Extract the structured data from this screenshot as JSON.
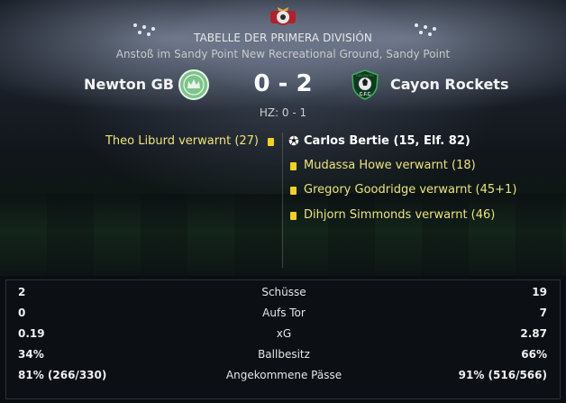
{
  "competition": {
    "title": "TABELLE DER PRIMERA DIVISIÓN",
    "venue": "Anstoß im Sandy Point New Recreational Ground, Sandy Point",
    "logo_icon": "competition-logo"
  },
  "match": {
    "home_team": "Newton GB",
    "away_team": "Cayon Rockets",
    "score": "0 - 2",
    "half_time": "HZ: 0 - 1",
    "home_crest_color": "#7dc48a",
    "away_crest_color": "#1f6a3a",
    "away_crest_text": "CAYON FC"
  },
  "events": {
    "home": [
      {
        "text": "Theo Liburd verwarnt (27)",
        "type": "yellow-card"
      }
    ],
    "away": [
      {
        "text": "Carlos Bertie (15, Elf. 82)",
        "type": "goal"
      },
      {
        "text": "Mudassa Howe verwarnt (18)",
        "type": "yellow-card"
      },
      {
        "text": "Gregory Goodridge verwarnt (45+1)",
        "type": "yellow-card"
      },
      {
        "text": "Dihjorn Simmonds verwarnt (46)",
        "type": "yellow-card"
      }
    ]
  },
  "stats": [
    {
      "label": "Schüsse",
      "home": "2",
      "away": "19"
    },
    {
      "label": "Aufs Tor",
      "home": "0",
      "away": "7"
    },
    {
      "label": "xG",
      "home": "0.19",
      "away": "2.87"
    },
    {
      "label": "Ballbesitz",
      "home": "34%",
      "away": "66%"
    },
    {
      "label": "Angekommene Pässe",
      "home": "81% (266/330)",
      "away": "91% (516/566)"
    }
  ],
  "colors": {
    "card_yellow": "#f2d21b",
    "event_text": "#ece37a",
    "panel_bg": "#0c0f14"
  }
}
